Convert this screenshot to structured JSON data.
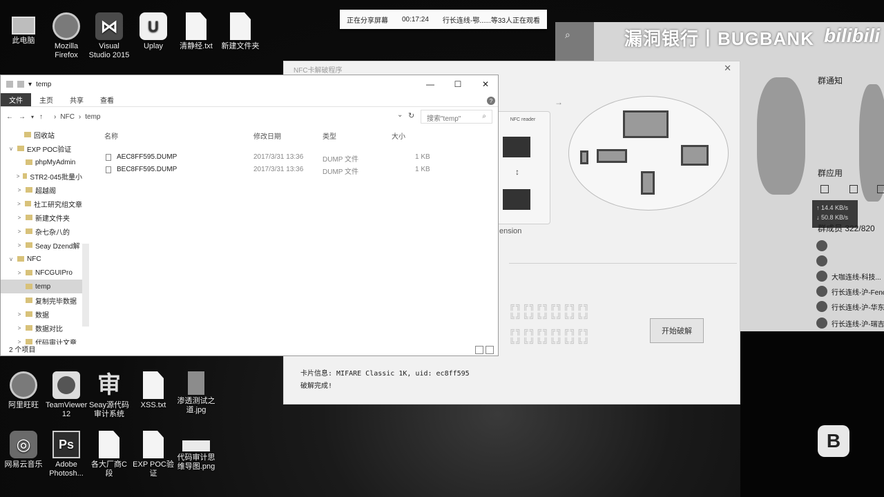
{
  "share_bar": {
    "status": "正在分享屏幕",
    "timer": "00:17:24",
    "viewers": "行长连线-鄂......等33人正在观看"
  },
  "desktop_top_icons": [
    {
      "label": "此电脑",
      "icon": "computer-icon"
    },
    {
      "label": "Mozilla Firefox",
      "icon": "firefox-icon"
    },
    {
      "label": "Visual Studio 2015",
      "icon": "visual-studio-icon"
    },
    {
      "label": "Uplay",
      "icon": "uplay-icon"
    },
    {
      "label": "清静经.txt",
      "icon": "text-file-icon"
    },
    {
      "label": "新建文件夹",
      "icon": "folder-icon"
    }
  ],
  "desktop_bottom_icons": [
    {
      "label": "阿里旺旺",
      "icon": "aliwangwang-icon"
    },
    {
      "label": "TeamViewer 12",
      "icon": "teamviewer-icon"
    },
    {
      "label": "Seay源代码审计系统",
      "icon": "seay-audit-icon"
    },
    {
      "label": "XSS.txt",
      "icon": "text-file-icon"
    },
    {
      "label": "渗透测试之道.jpg",
      "icon": "image-file-icon"
    },
    {
      "label": "网易云音乐",
      "icon": "netease-music-icon"
    },
    {
      "label": "Adobe Photosh...",
      "icon": "photoshop-icon"
    },
    {
      "label": "各大厂商C段",
      "icon": "document-icon"
    },
    {
      "label": "EXP POC验证",
      "icon": "document-icon"
    },
    {
      "label": "代码审计思维导图.png",
      "icon": "image-file-icon"
    }
  ],
  "stream_panel": {
    "logo": "漏洞银行丨BUGBANK",
    "brand": "bilibili",
    "notice_heading": "群通知",
    "apps_heading": "群应用",
    "upload_speed": "↑ 14.4 KB/s",
    "download_speed": "↓ 50.8 KB/s",
    "member_count": "群成员 322/820",
    "chat_items": [
      "大咖连线-科技...",
      "行长连线-沪-Fenc",
      "行长连线-沪-华东",
      "行长连线-沪-瑞吉"
    ]
  },
  "nfc_window": {
    "title": "NFC卡解破程序",
    "crack_button": "开始破解",
    "card_info": "卡片信息: MIFARE Classic 1K, uid: ec8ff595",
    "crack_result": "破解完成!",
    "ascii_art": "╔╗╔╗╔╗╔╗╔╗╔╗\n╚╝╚╝╚╝╚╝╚╝╚╝\n╔╗╔╗╔╗╔╗╔╗╔╗\n╚╝╚╝╚╝╚╝╚╝╚╝",
    "extension_text": "ension"
  },
  "explorer": {
    "title": "temp",
    "ribbon_tabs": [
      "文件",
      "主页",
      "共享",
      "查看"
    ],
    "path": [
      "NFC",
      "temp"
    ],
    "search_placeholder": "搜索\"temp\"",
    "columns": {
      "name": "名称",
      "modified": "修改日期",
      "type": "类型",
      "size": "大小"
    },
    "tree": [
      {
        "label": "回收站",
        "expander": ""
      },
      {
        "label": "EXP POC验证",
        "expander": "v"
      },
      {
        "label": "phpMyAdmin",
        "expander": ""
      },
      {
        "label": "STR2-045批量小",
        "expander": ">"
      },
      {
        "label": "超越阁",
        "expander": ">"
      },
      {
        "label": "社工研究组文章",
        "expander": ">"
      },
      {
        "label": "新建文件夹",
        "expander": ">"
      },
      {
        "label": "杂七杂八的",
        "expander": ">"
      },
      {
        "label": "Seay Dzend解",
        "expander": ">"
      },
      {
        "label": "NFC",
        "expander": "v"
      },
      {
        "label": "NFCGUIPro",
        "expander": ">"
      },
      {
        "label": "temp",
        "expander": ""
      },
      {
        "label": "复制完毕数据",
        "expander": ""
      },
      {
        "label": "数据",
        "expander": ">"
      },
      {
        "label": "数据对比",
        "expander": ">"
      },
      {
        "label": "代码审计文章",
        "expander": ">"
      }
    ],
    "files": [
      {
        "name": "AEC8FF595.DUMP",
        "modified": "2017/3/31 13:36",
        "type": "DUMP 文件",
        "size": "1 KB"
      },
      {
        "name": "BEC8FF595.DUMP",
        "modified": "2017/3/31 13:36",
        "type": "DUMP 文件",
        "size": "1 KB"
      }
    ],
    "status": "2 个项目"
  }
}
